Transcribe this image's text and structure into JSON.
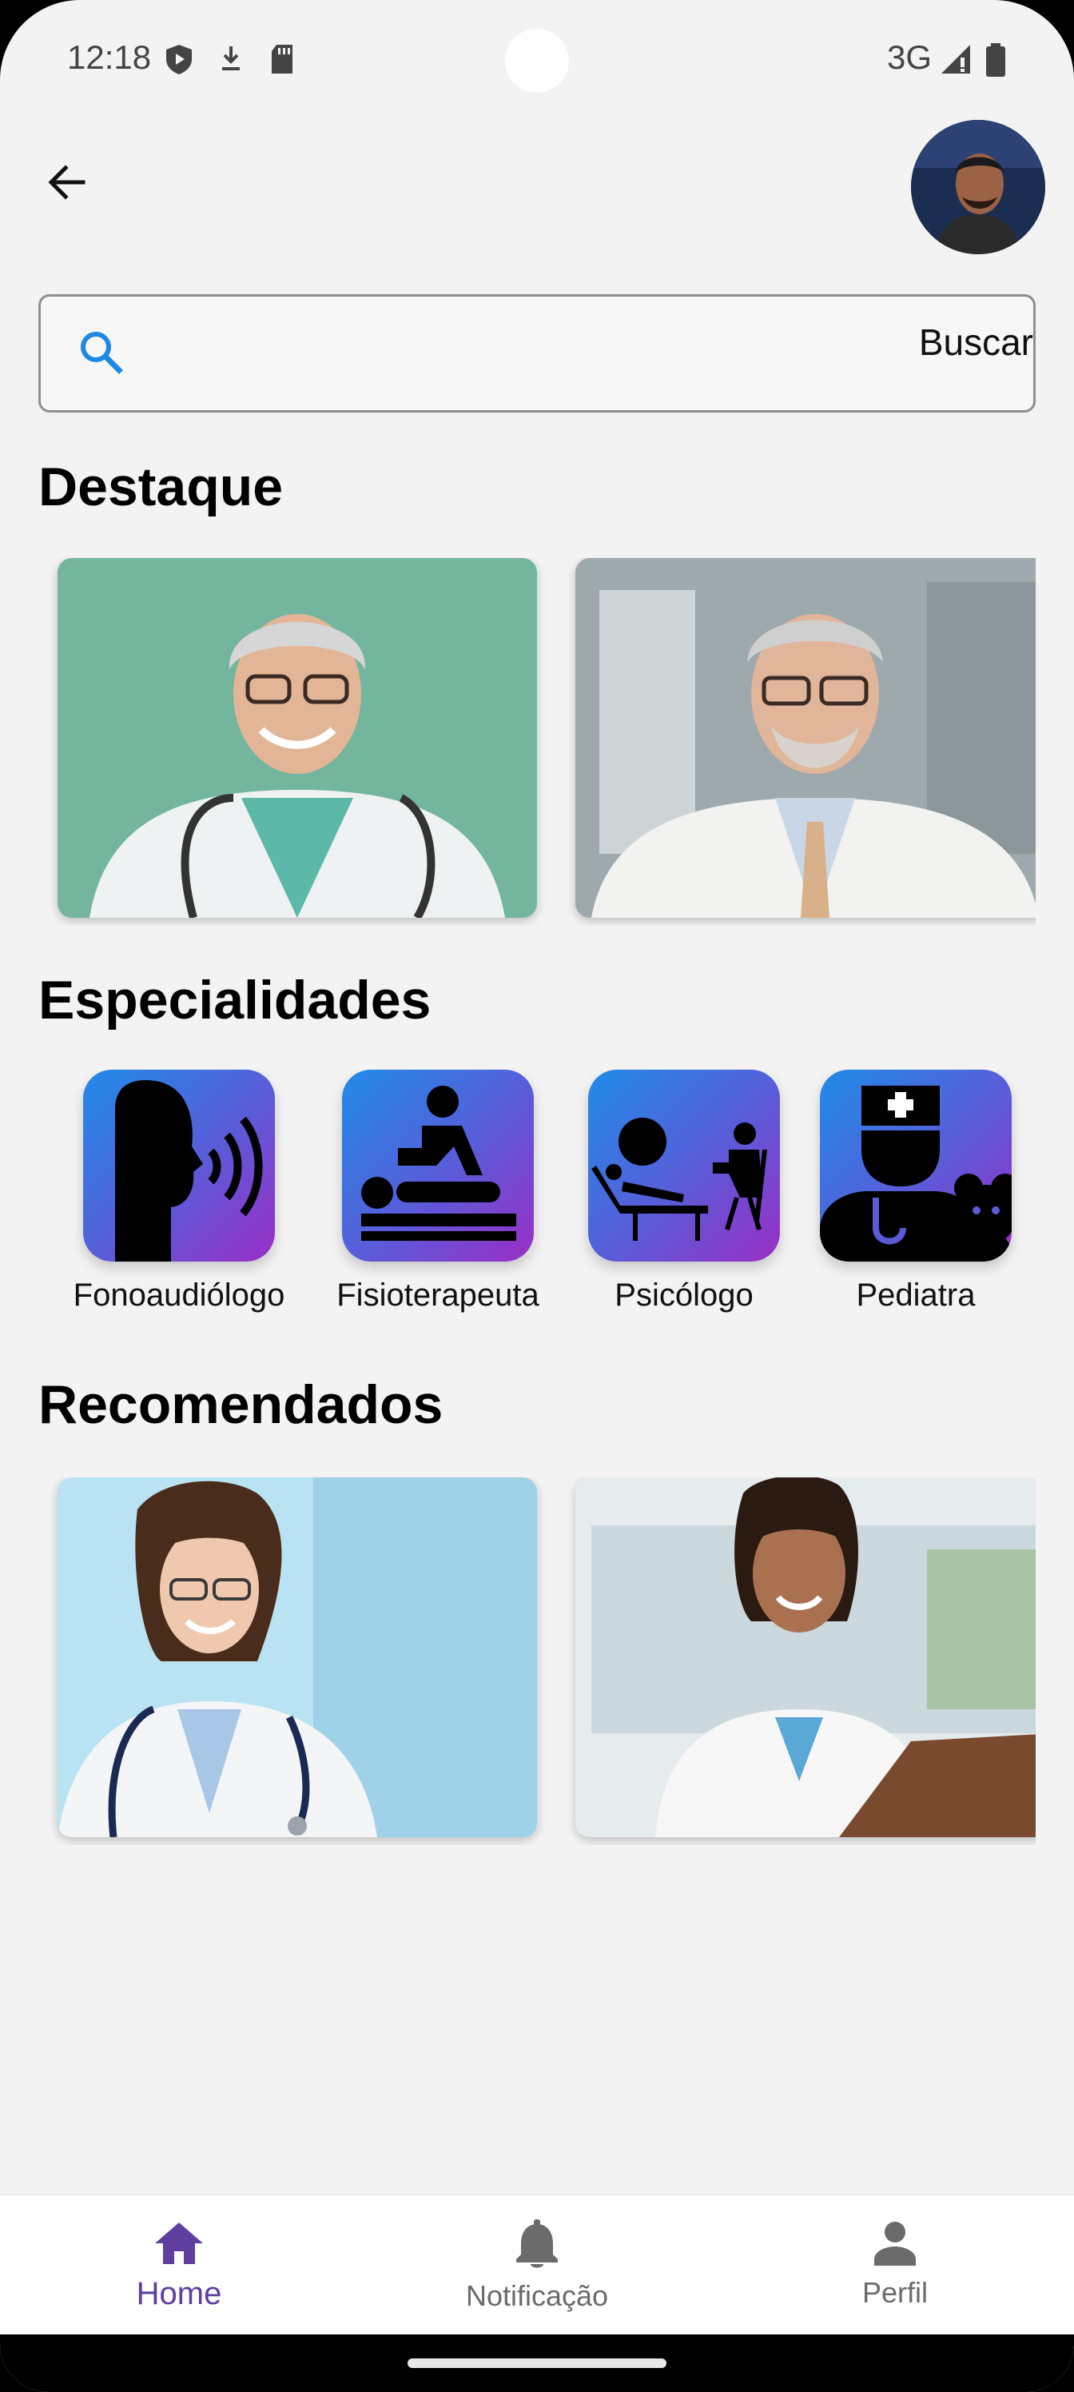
{
  "status_bar": {
    "time": "12:18",
    "network": "3G",
    "left_icons": [
      "shield-icon",
      "download-icon",
      "sd-card-icon"
    ],
    "right_icons": [
      "signal-icon",
      "battery-icon"
    ]
  },
  "header": {
    "back_icon": "arrow-left-icon",
    "avatar": "user-avatar"
  },
  "search": {
    "placeholder": "",
    "value": "",
    "button_label": "Buscar",
    "icon": "search-icon",
    "accent": "#1e88e5"
  },
  "sections": {
    "featured_title": "Destaque",
    "specialties_title": "Especialidades",
    "recommended_title": "Recomendados"
  },
  "featured": [
    {
      "image": "doctor-photo-1"
    },
    {
      "image": "doctor-photo-2"
    }
  ],
  "specialties": [
    {
      "label": "Fonoaudiólogo",
      "icon": "speech-icon"
    },
    {
      "label": "Fisioterapeuta",
      "icon": "massage-icon"
    },
    {
      "label": "Psicólogo",
      "icon": "psychology-icon"
    },
    {
      "label": "Pediatra",
      "icon": "pediatrician-icon"
    }
  ],
  "recommended": [
    {
      "image": "doctor-photo-3"
    },
    {
      "image": "doctor-photo-4"
    }
  ],
  "bottom_nav": {
    "items": [
      {
        "label": "Home",
        "icon": "home-icon",
        "active": true
      },
      {
        "label": "Notificação",
        "icon": "bell-icon",
        "active": false
      },
      {
        "label": "Perfil",
        "icon": "person-icon",
        "active": false
      }
    ],
    "active_color": "#5e3fa0",
    "inactive_color": "#6b6b6b"
  }
}
